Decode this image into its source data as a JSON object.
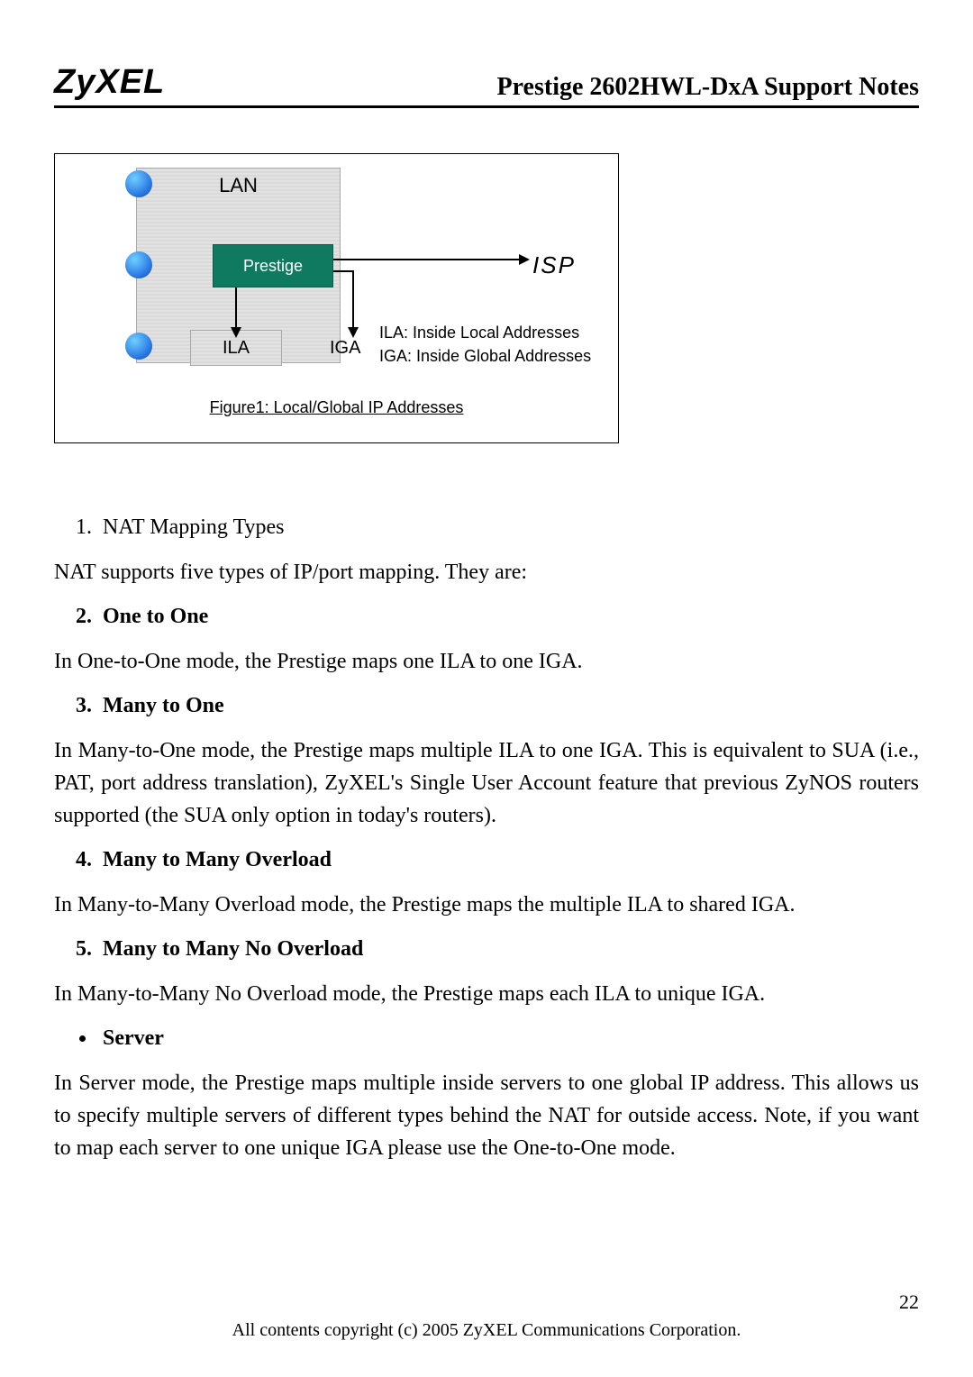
{
  "header": {
    "logo": "ZyXEL",
    "title": "Prestige 2602HWL-DxA Support Notes"
  },
  "figure": {
    "lan": "LAN",
    "prestige": "Prestige",
    "ila": "ILA",
    "iga": "IGA",
    "isp": "ISP",
    "desc1": "ILA: Inside Local Addresses",
    "desc2": "IGA: Inside Global Addresses",
    "caption": "Figure1: Local/Global IP Addresses"
  },
  "list": {
    "item1": "NAT Mapping Types",
    "item2": "One to One",
    "item3": "Many to One",
    "item4": "Many to Many Overload",
    "item5": "Many to Many No Overload",
    "bullet1": "Server"
  },
  "para": {
    "p1": "NAT supports five types of IP/port mapping. They are:",
    "p2": "In One-to-One mode, the Prestige maps one ILA to one IGA.",
    "p3": "In Many-to-One mode, the Prestige maps multiple ILA to one IGA. This is equivalent to SUA (i.e., PAT, port address translation), ZyXEL's Single User Account feature that previous ZyNOS routers supported (the SUA only option in today's routers).",
    "p4": "In Many-to-Many Overload mode, the Prestige maps the multiple ILA to shared IGA.",
    "p5": "In Many-to-Many No Overload mode, the Prestige maps each ILA to unique IGA.",
    "p6": "In Server mode, the Prestige maps multiple inside servers to one global IP address. This allows us to specify multiple servers of different types behind the NAT for outside access. Note, if you want to map each server to one unique IGA please use the One-to-One mode."
  },
  "footer": {
    "page": "22",
    "copyright": "All contents copyright (c) 2005 ZyXEL Communications Corporation."
  }
}
